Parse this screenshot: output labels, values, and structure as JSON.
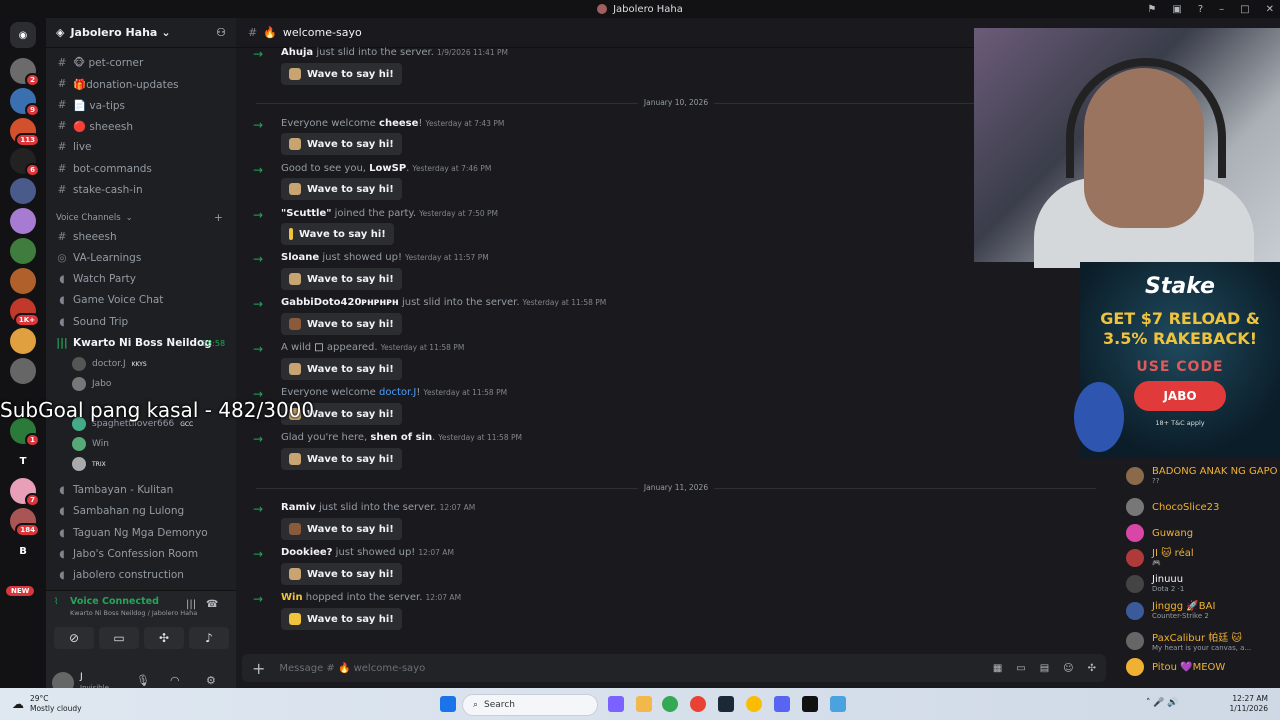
{
  "window": {
    "title": "Jabolero Haha"
  },
  "servers": {
    "badges": [
      "2",
      "9",
      "113",
      "6",
      "1K+",
      "1",
      "7",
      "184"
    ],
    "letters": [
      "T",
      "B"
    ],
    "new_label": "NEW"
  },
  "sidebar": {
    "server_name": "Jabolero Haha",
    "text_channels": [
      "🐵 pet-corner",
      "🎁donation-updates",
      "📄 va-tips",
      "🔴 sheeesh",
      "live",
      "bot-commands",
      "stake-cash-in"
    ],
    "voice_header": "Voice Channels",
    "voice_channels": [
      "sheeesh",
      "VA-Learnings",
      "Watch Party",
      "Game Voice Chat",
      "Sound Trip",
      "Kwarto Ni Boss Neildog"
    ],
    "active_timer": "28:58",
    "voice_users": [
      "doctor.J",
      "Jabo",
      "",
      "spaghettilover666",
      "Win",
      ""
    ],
    "voice_user_tags": [
      "KKYS",
      "",
      "",
      "GCC",
      "",
      "TRIX"
    ],
    "more_channels": [
      "Tambayan - Kulitan",
      "Sambahan ng Lulong",
      "Taguan Ng Mga Demonyo",
      "Jabo's Confession Room",
      "jabolero construction"
    ],
    "voice_status": "Voice Connected",
    "voice_location": "Kwarto Ni Boss Neildog / Jabolero Haha",
    "user_name": "J",
    "user_status": "Invisible"
  },
  "channel": {
    "name": "welcome-sayo",
    "composer_placeholder": "Message # 🔥 welcome-sayo"
  },
  "messages": [
    {
      "pre": "",
      "name": "Ahuja",
      "post": " just slid into the server.",
      "ts": "1/9/2026 11:41 PM"
    },
    {
      "pre": "Everyone welcome ",
      "name": "cheese",
      "post": "!",
      "ts": "Yesterday at 7:43 PM"
    },
    {
      "pre": "Good to see you, ",
      "name": "LowSP",
      "post": ".",
      "ts": "Yesterday at 7:46 PM"
    },
    {
      "pre": "",
      "name": "\"Scuttle\"",
      "post": " joined the party.",
      "ts": "Yesterday at 7:50 PM"
    },
    {
      "pre": "",
      "name": "Sloane",
      "post": " just showed up!",
      "ts": "Yesterday at 11:57 PM"
    },
    {
      "pre": "",
      "name": "GabbiDoto420ᴘʜᴘʜᴘʜ",
      "post": " just slid into the server.",
      "ts": "Yesterday at 11:58 PM"
    },
    {
      "pre": "A wild ",
      "name": "□",
      "post": " appeared.",
      "ts": "Yesterday at 11:58 PM"
    },
    {
      "pre": "Everyone welcome ",
      "name": "doctor.J",
      "post": "!",
      "ts": "Yesterday at 11:58 PM"
    },
    {
      "pre": "Glad you're here, ",
      "name": "shen of sin",
      "post": ".",
      "ts": "Yesterday at 11:58 PM"
    },
    {
      "pre": "",
      "name": "Ramiv",
      "post": " just slid into the server.",
      "ts": "12:07 AM"
    },
    {
      "pre": "",
      "name": "Dookiee?",
      "post": " just showed up!",
      "ts": "12:07 AM"
    },
    {
      "pre": "",
      "name": "Win",
      "post": " hopped into the server.",
      "ts": "12:07 AM"
    }
  ],
  "wave_label": "Wave to say hi!",
  "dates": [
    "January 10, 2026",
    "January 11, 2026"
  ],
  "overlay_text": "SubGoal pang kasal - 482/3000",
  "ad": {
    "brand": "Stake",
    "headline1": "GET $7 RELOAD &",
    "headline2": "3.5% RAKEBACK!",
    "use_code": "USE CODE",
    "code": "JABO",
    "tc": "18+ T&C apply"
  },
  "members": [
    {
      "name": "BADONG ANAK NG GAPO",
      "sub": "??"
    },
    {
      "name": "ChocoSlice23",
      "sub": ""
    },
    {
      "name": "Guwang",
      "sub": ""
    },
    {
      "name": "JI 🐱 réal",
      "sub": "🎮"
    },
    {
      "name": "Jinuuu",
      "sub": "Dota 2 ·1"
    },
    {
      "name": "Jinggg 🚀BAI",
      "sub": "Counter-Strike 2"
    },
    {
      "name": "PaxCalibur 帕廷 🐱",
      "sub": "My heart is your canvas, a..."
    },
    {
      "name": "Pitou 💜MEOW",
      "sub": ""
    }
  ],
  "taskbar": {
    "temp": "29°C",
    "weather": "Mostly cloudy",
    "search": "Search",
    "time": "12:27 AM",
    "date": "1/11/2026"
  }
}
